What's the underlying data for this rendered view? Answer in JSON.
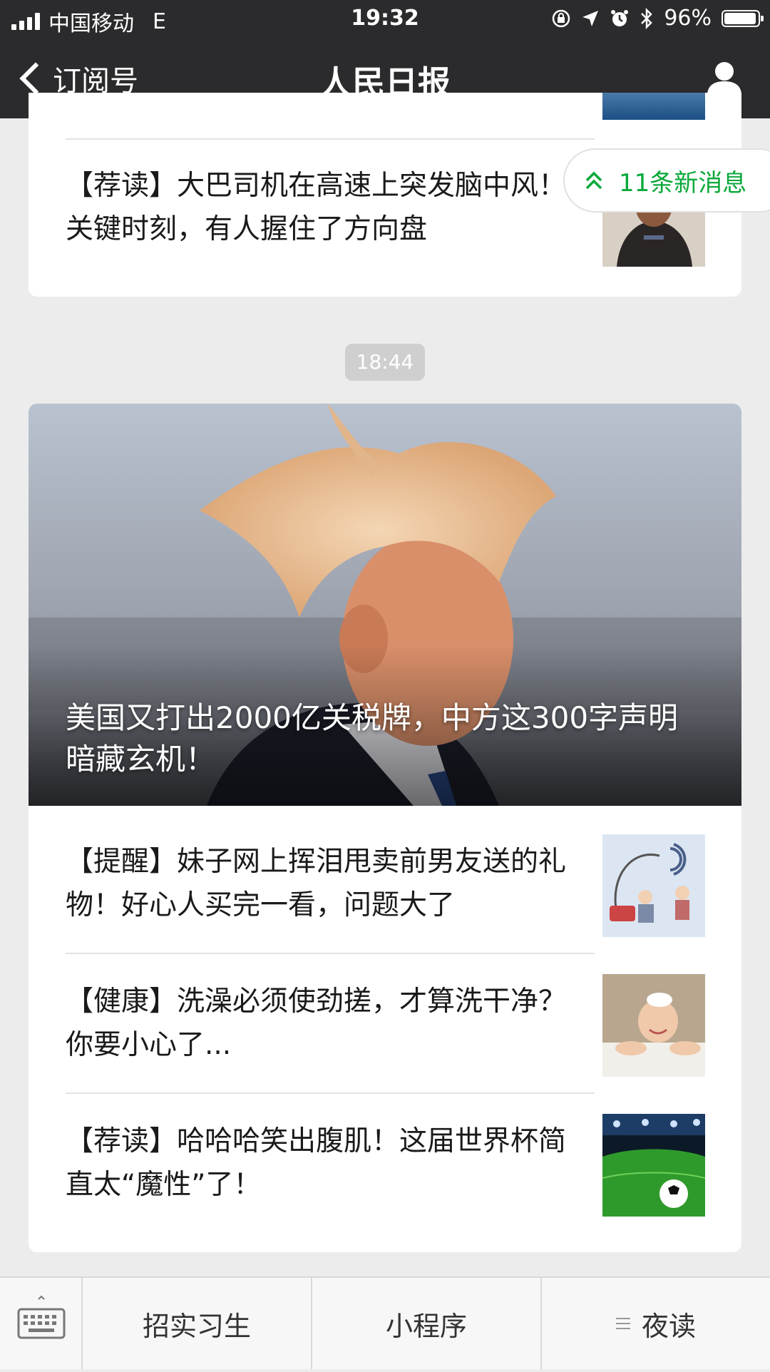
{
  "status": {
    "carrier": "中国移动",
    "network": "E",
    "time": "19:32",
    "battery_text": "96%",
    "battery_level": 0.96
  },
  "nav": {
    "back_label": "订阅号",
    "title": "人民日报"
  },
  "new_messages": "11条新消息",
  "card1": {
    "items": [
      {
        "text": "【荐读】大巴司机在高速上突发脑中风！关键时刻，有人握住了方向盘"
      }
    ]
  },
  "timestamp": "18:44",
  "card2": {
    "hero_title": "美国又打出2000亿关税牌，中方这300字声明暗藏玄机！",
    "items": [
      {
        "text": "【提醒】妹子网上挥泪甩卖前男友送的礼物！好心人买完一看，问题大了"
      },
      {
        "text": "【健康】洗澡必须使劲搓，才算洗干净？你要小心了..."
      },
      {
        "text": "【荐读】哈哈哈笑出腹肌！这届世界杯简直太“魔性”了！"
      }
    ]
  },
  "bottom_menu": {
    "items": [
      "招实习生",
      "小程序",
      "夜读"
    ]
  },
  "colors": {
    "bar": "#2b2b2d",
    "accent_green": "#09a839",
    "background": "#ececec"
  }
}
